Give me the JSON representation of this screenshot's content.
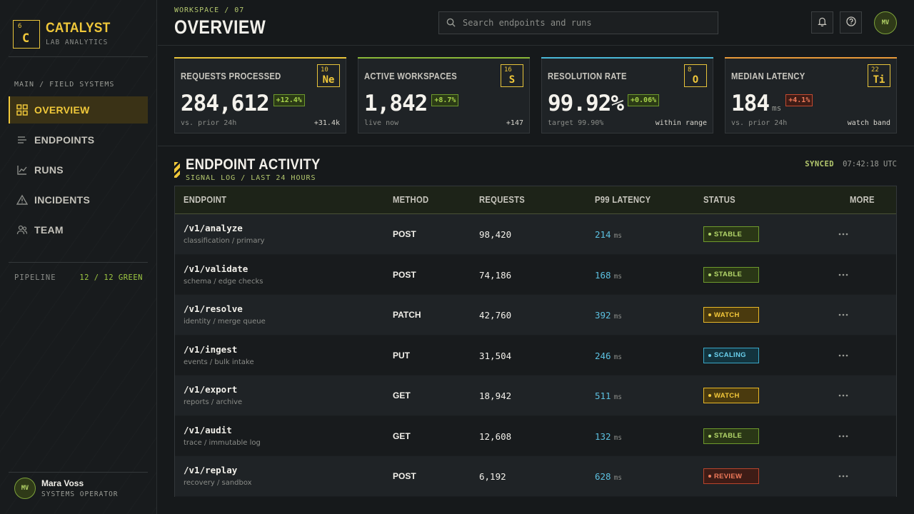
{
  "brand": {
    "tile_number": "6",
    "tile_symbol": "C",
    "name": "CATALYST",
    "subtitle": "LAB ANALYTICS"
  },
  "sidebar": {
    "section_label": "MAIN / FIELD SYSTEMS",
    "items": [
      {
        "label": "OVERVIEW",
        "icon": "grid-icon",
        "active": true
      },
      {
        "label": "ENDPOINTS",
        "icon": "list-icon"
      },
      {
        "label": "RUNS",
        "icon": "chart-line-icon"
      },
      {
        "label": "INCIDENTS",
        "icon": "warning-icon"
      },
      {
        "label": "TEAM",
        "icon": "users-icon"
      }
    ],
    "pipeline_label": "PIPELINE",
    "pipeline_value": "12 / 12 GREEN",
    "user": {
      "initials": "MV",
      "name": "Mara Voss",
      "role": "SYSTEMS OPERATOR"
    }
  },
  "header": {
    "breadcrumb": "WORKSPACE / 07",
    "title": "OVERVIEW",
    "search_placeholder": "Search endpoints and runs",
    "avatar_initials": "MV"
  },
  "kpis": [
    {
      "label": "REQUESTS PROCESSED",
      "tile_number": "10",
      "tile_symbol": "Ne",
      "value": "284,612",
      "unit": "",
      "delta": "+12.4%",
      "delta_dir": "up",
      "foot_left": "vs. prior 24h",
      "foot_right": "+31.4k",
      "accent": "#e8c43a"
    },
    {
      "label": "ACTIVE WORKSPACES",
      "tile_number": "16",
      "tile_symbol": "S",
      "value": "1,842",
      "unit": "",
      "delta": "+8.7%",
      "delta_dir": "up",
      "foot_left": "live now",
      "foot_right": "+147",
      "accent": "#8ab838"
    },
    {
      "label": "RESOLUTION RATE",
      "tile_number": "8",
      "tile_symbol": "O",
      "value": "99.92%",
      "unit": "",
      "delta": "+0.06%",
      "delta_dir": "up",
      "foot_left": "target 99.90%",
      "foot_right": "within range",
      "accent": "#4ab8d8"
    },
    {
      "label": "MEDIAN LATENCY",
      "tile_number": "22",
      "tile_symbol": "Ti",
      "value": "184",
      "unit": "ms",
      "delta": "+4.1%",
      "delta_dir": "down",
      "foot_left": "vs. prior 24h",
      "foot_right": "watch band",
      "accent": "#e89a3a"
    }
  ],
  "activity": {
    "title": "ENDPOINT ACTIVITY",
    "subtitle": "SIGNAL LOG / LAST 24 HOURS",
    "sync_label": "SYNCED",
    "sync_time": "07:42:18 UTC",
    "columns": [
      "ENDPOINT",
      "METHOD",
      "REQUESTS",
      "P99 LATENCY",
      "STATUS",
      "MORE"
    ],
    "rows": [
      {
        "endpoint": "/v1/analyze",
        "desc": "classification / primary",
        "method": "POST",
        "requests": "98,420",
        "latency": "214",
        "unit": "ms",
        "status": "STABLE",
        "status_kind": "stable"
      },
      {
        "endpoint": "/v1/validate",
        "desc": "schema / edge checks",
        "method": "POST",
        "requests": "74,186",
        "latency": "168",
        "unit": "ms",
        "status": "STABLE",
        "status_kind": "stable"
      },
      {
        "endpoint": "/v1/resolve",
        "desc": "identity / merge queue",
        "method": "PATCH",
        "requests": "42,760",
        "latency": "392",
        "unit": "ms",
        "status": "WATCH",
        "status_kind": "watch"
      },
      {
        "endpoint": "/v1/ingest",
        "desc": "events / bulk intake",
        "method": "PUT",
        "requests": "31,504",
        "latency": "246",
        "unit": "ms",
        "status": "SCALING",
        "status_kind": "scaling"
      },
      {
        "endpoint": "/v1/export",
        "desc": "reports / archive",
        "method": "GET",
        "requests": "18,942",
        "latency": "511",
        "unit": "ms",
        "status": "WATCH",
        "status_kind": "watch"
      },
      {
        "endpoint": "/v1/audit",
        "desc": "trace / immutable log",
        "method": "GET",
        "requests": "12,608",
        "latency": "132",
        "unit": "ms",
        "status": "STABLE",
        "status_kind": "stable"
      },
      {
        "endpoint": "/v1/replay",
        "desc": "recovery / sandbox",
        "method": "POST",
        "requests": "6,192",
        "latency": "628",
        "unit": "ms",
        "status": "REVIEW",
        "status_kind": "review"
      }
    ]
  }
}
